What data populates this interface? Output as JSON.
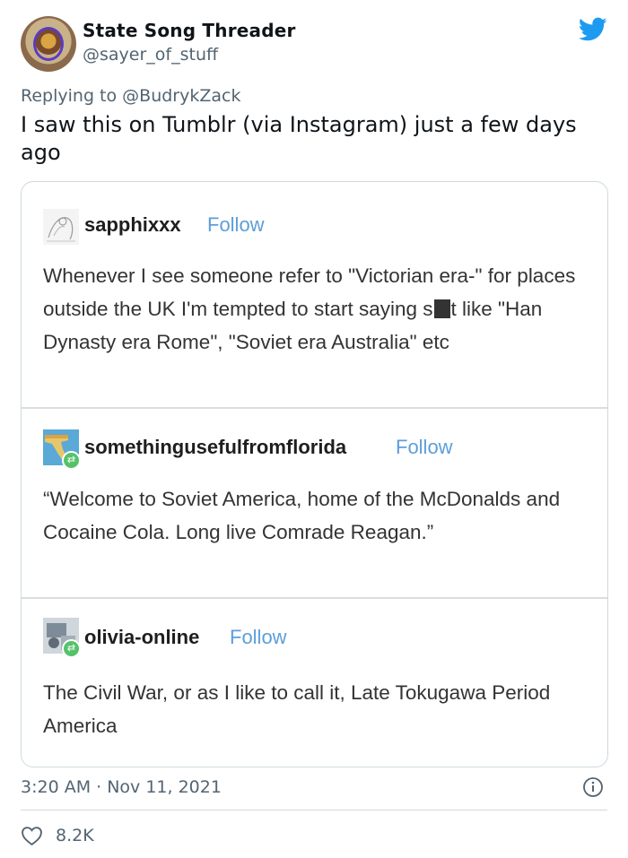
{
  "tweet": {
    "author": {
      "display_name": "State Song Threader",
      "handle": "@sayer_of_stuff"
    },
    "replying_to_prefix": "Replying to ",
    "replying_to": "@BudrykZack",
    "text": "I saw this on Tumblr (via Instagram) just a few days ago",
    "timestamp": "3:20 AM · Nov 11, 2021",
    "likes": "8.2K",
    "brand_color": "#1d9bf0"
  },
  "tumblr": {
    "follow_label": "Follow",
    "posts": [
      {
        "user": "sapphixxx",
        "body_before_redaction": "Whenever I see someone refer to \"Victorian era-\" for places outside the UK I'm tempted to start saying s",
        "body_after_redaction": "t like \"Han Dynasty era Rome\", \"Soviet era Australia\" etc"
      },
      {
        "user": "somethingusefulfromflorida",
        "body": "“Welcome to Soviet America, home of the McDonalds and Cocaine Cola.  Long live Comrade Reagan.”"
      },
      {
        "user": "olivia-online",
        "body": "The Civil War, or as I like to call it, Late Tokugawa Period America"
      }
    ]
  }
}
